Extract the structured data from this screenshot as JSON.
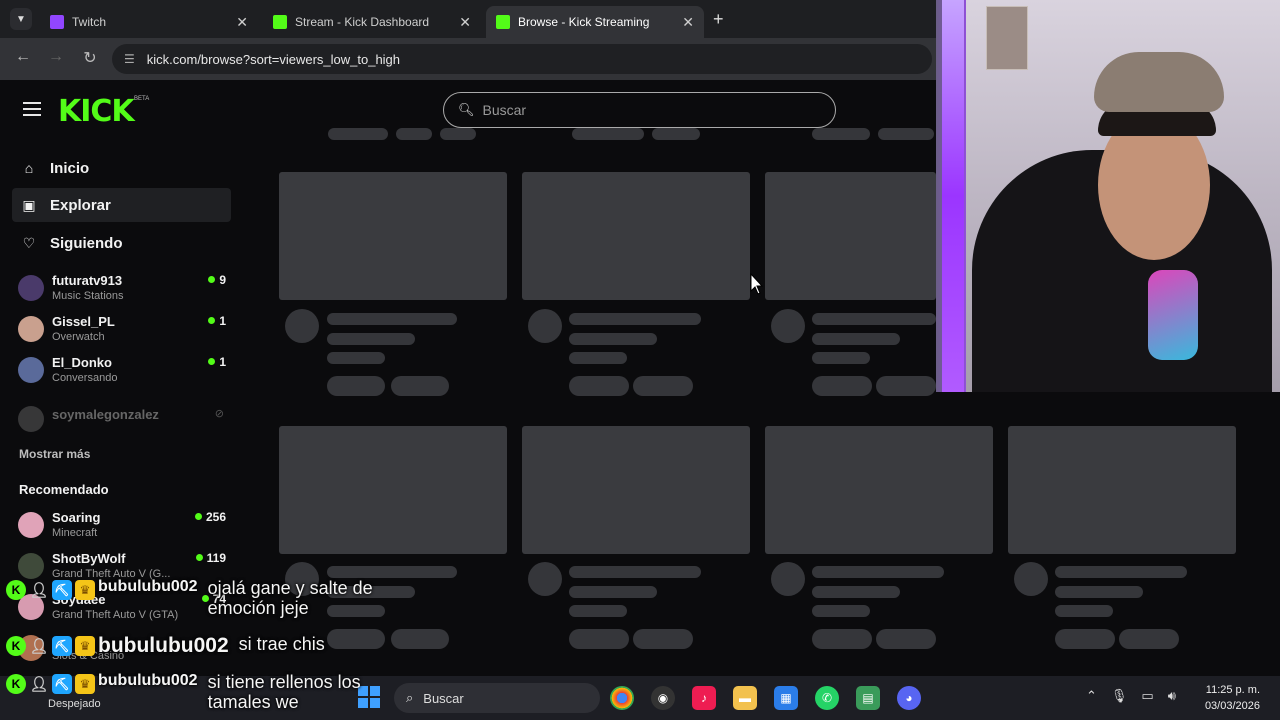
{
  "browser": {
    "tabs": [
      {
        "label": "Twitch",
        "active": false
      },
      {
        "label": "Stream - Kick Dashboard",
        "active": false
      },
      {
        "label": "Browse - Kick Streaming",
        "active": true
      }
    ],
    "url": "kick.com/browse?sort=viewers_low_to_high"
  },
  "kick": {
    "logo": "KICK",
    "logo_badge": "BETA",
    "search_placeholder": "Buscar"
  },
  "sidebar": {
    "nav": [
      {
        "label": "Inicio",
        "icon": "home-icon"
      },
      {
        "label": "Explorar",
        "icon": "compass-icon"
      },
      {
        "label": "Siguiendo",
        "icon": "heart-icon"
      }
    ],
    "following": [
      {
        "name": "futuratv913",
        "category": "Music Stations",
        "viewers": "9"
      },
      {
        "name": "Gissel_PL",
        "category": "Overwatch",
        "viewers": "1"
      },
      {
        "name": "El_Donko",
        "category": "Conversando",
        "viewers": "1"
      },
      {
        "name": "soymalegonzalez",
        "category": "",
        "viewers": ""
      }
    ],
    "show_more": "Mostrar más",
    "recommended_title": "Recomendado",
    "recommended": [
      {
        "name": "Soaring",
        "category": "Minecraft",
        "viewers": "256"
      },
      {
        "name": "ShotByWolf",
        "category": "Grand Theft Auto V (G...",
        "viewers": "119"
      },
      {
        "name": "Soydaee",
        "category": "Grand Theft Auto V (GTA)",
        "viewers": "74"
      },
      {
        "name": "",
        "category": "Slots & Casino",
        "viewers": ""
      }
    ]
  },
  "chat": [
    {
      "user": "bubulubu002",
      "message": "ojalá gane y salte de emoción jeje"
    },
    {
      "user": "bubulubu002",
      "message": "si trae chis"
    },
    {
      "user": "bubulubu002",
      "message": "si tiene rellenos los tamales we"
    }
  ],
  "taskbar": {
    "weather": "Despejado",
    "search_placeholder": "Buscar",
    "time": "11:25 p. m.",
    "date": "03/03/2026"
  }
}
